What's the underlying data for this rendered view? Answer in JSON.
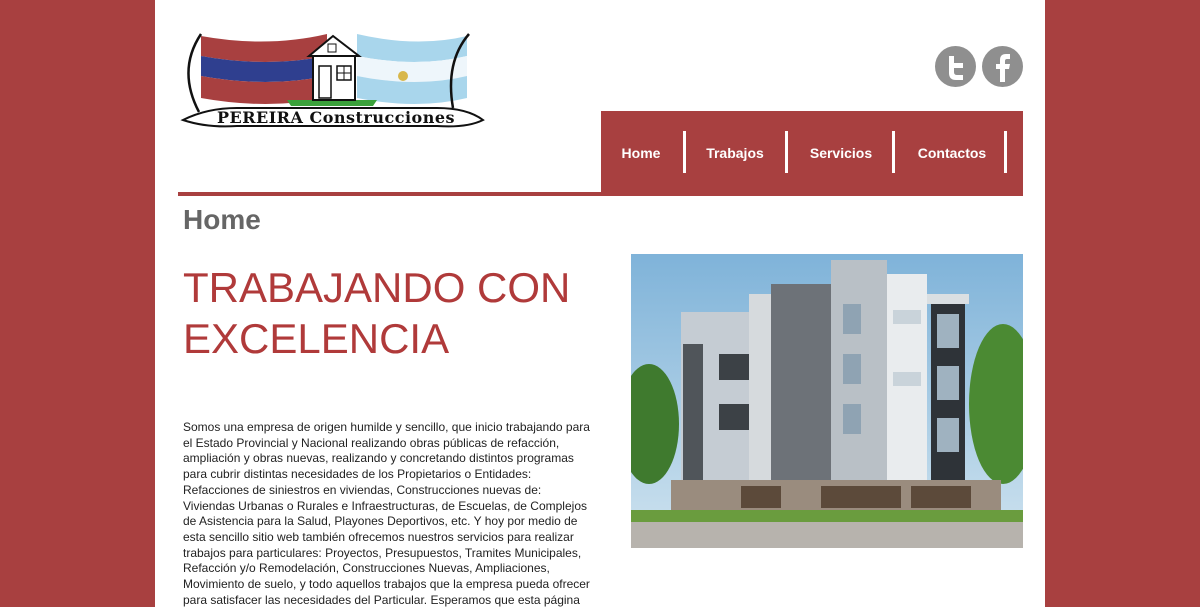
{
  "brand": {
    "logo_text": "PEREIRA Construcciones"
  },
  "social": {
    "twitter_icon": "twitter-icon",
    "facebook_icon": "facebook-icon"
  },
  "nav": {
    "items": [
      {
        "label": "Home"
      },
      {
        "label": "Trabajos"
      },
      {
        "label": "Servicios"
      },
      {
        "label": "Contactos"
      }
    ]
  },
  "colors": {
    "background": "#a84040",
    "accent": "#a84040",
    "headline": "#b03a3a",
    "heading": "#666666",
    "icons": "#8f8f8f"
  },
  "main": {
    "page_title": "Home",
    "headline": "TRABAJANDO CON EXCELENCIA",
    "body": "Somos una empresa de origen humilde y sencillo, que inicio trabajando para el Estado Provincial y Nacional realizando obras públicas de refacción, ampliación y obras nuevas, realizando y concretando distintos programas para cubrir distintas necesidades de los Propietarios o Entidades: Refacciones de siniestros en viviendas, Construcciones nuevas de: Viviendas Urbanas o Rurales e Infraestructuras, de Escuelas, de Complejos de Asistencia para la Salud, Playones Deportivos, etc. Y hoy por medio de esta sencillo sitio web también ofrecemos nuestros servicios para realizar trabajos para particulares: Proyectos, Presupuestos, Tramites Municipales, Refacción y/o Remodelación, Construcciones Nuevas, Ampliaciones, Movimiento de suelo, y todo aquellos trabajos que la empresa pueda ofrecer para satisfacer las necesidades del Particular. Esperamos que esta página sea un nexo de comunicación para que usted pueda contactarnos"
  }
}
